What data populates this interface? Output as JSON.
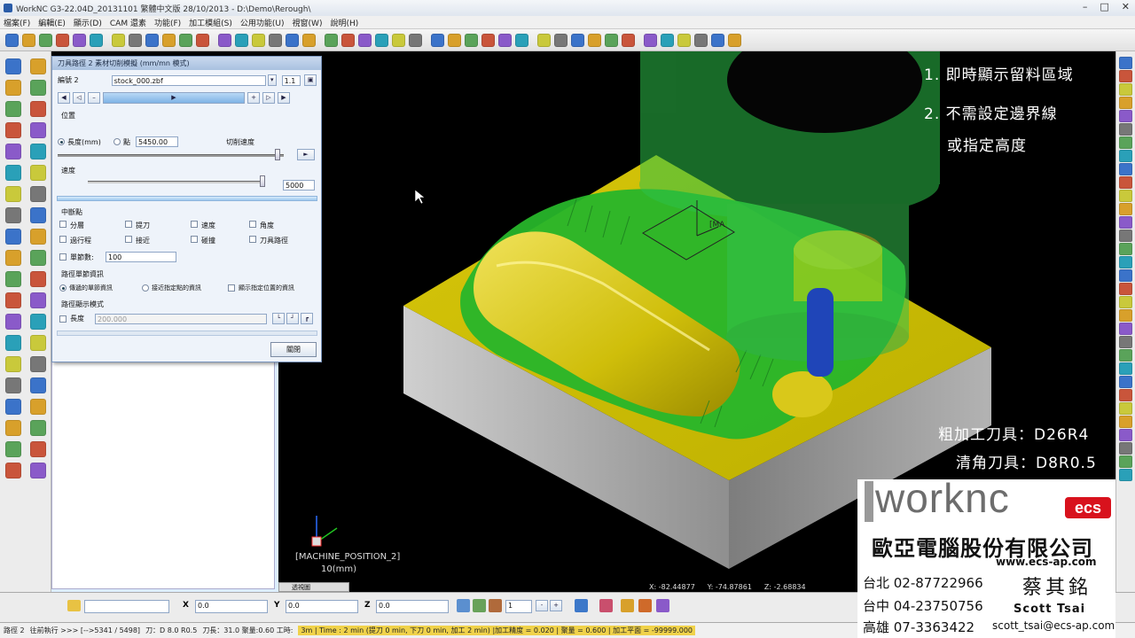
{
  "window": {
    "title": "WorkNC G3-22.04D_20131101 繁體中文版   28/10/2013 - D:\\Demo\\Rerough\\"
  },
  "menu": [
    "檔案(F)",
    "編輯(E)",
    "顯示(D)",
    "CAM 還素",
    "功能(F)",
    "加工模組(S)",
    "公用功能(U)",
    "視窗(W)",
    "說明(H)"
  ],
  "dialog": {
    "title": "刀具路徑 2 素材切削模擬 (mm/mn 模式)",
    "path_label": "編號 2",
    "stock_file": "stock_000.zbf",
    "scale_value": "1.1",
    "section_position": "位置",
    "radio_length": "長度(mm)",
    "radio_point": "點",
    "point_value": "5450.00",
    "cut_speed_label": "切削速度",
    "speed_label": "速度",
    "speed_value": "5000",
    "section_break": "中斷點",
    "checks": [
      "分層",
      "提刀",
      "速度",
      "角度",
      "過行程",
      "接近",
      "碰撞",
      "刀具路徑"
    ],
    "blocks_label": "單節數:",
    "blocks_value": "100",
    "section_block_info": "路徑單節資訊",
    "radio_info": [
      "傳遞的單節資訊",
      "接近指定點的資訊",
      "顯示指定位置的資訊"
    ],
    "section_display": "路徑顯示模式",
    "length_label": "長度",
    "length_value": "200.000",
    "close_button": "關閉"
  },
  "viewport": {
    "annotations": [
      "1. 即時顯示留料區域",
      "2. 不需設定邊界線",
      "或指定高度",
      "粗加工刀具：D26R4",
      "清角刀具：D8R0.5"
    ],
    "machine_label": "[MACHINE_POSITION_2]",
    "scale_label": "10(mm)",
    "tag_label": "[MA",
    "coords": {
      "x": "X: -82.44877",
      "y": "Y: -74.87861",
      "z": "Z: -2.68834"
    }
  },
  "tabs": {
    "tab1": "透視圖"
  },
  "bottom": {
    "x_label": "X",
    "x_value": "0.0",
    "y_label": "Y",
    "y_value": "0.0",
    "z_label": "Z",
    "z_value": "0.0",
    "num_value": "1"
  },
  "statusbar": {
    "segments": [
      "路徑 2",
      "往前執行 >>> [-->5341 / 5498]",
      "刀：D 8.0 R0.5",
      "刀長：31.0 聚量:0.60 工時:",
      "3m | Time : 2 min (提刀 0 min, 下刀 0 min, 加工 2 min) |加工精度 = 0.020 | 聚量 = 0.600 | 加工平面 = -99999.000"
    ]
  },
  "company": {
    "brand": "worknc",
    "badge": "ecs",
    "name": "歐亞電腦股份有限公司",
    "url": "www.ecs-ap.com",
    "phones": [
      "台北 02-87722966",
      "台中 04-23750756",
      "高雄 07-3363422"
    ],
    "person_cn": "蔡其銘",
    "person_en": "Scott Tsai",
    "email": "scott_tsai@ecs-ap.com"
  }
}
